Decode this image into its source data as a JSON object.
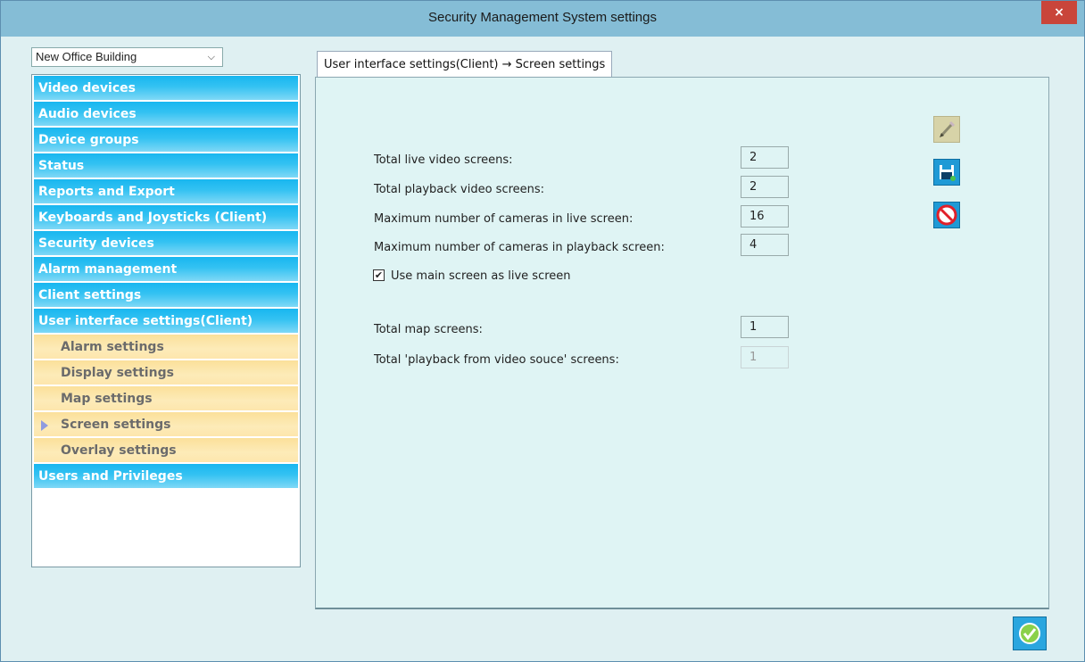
{
  "window": {
    "title": "Security Management System settings",
    "close_label": "×"
  },
  "site_selector": {
    "value": "New Office Building"
  },
  "nav": {
    "items": [
      {
        "label": "Video devices",
        "level": "top"
      },
      {
        "label": "Audio devices",
        "level": "top"
      },
      {
        "label": "Device groups",
        "level": "top"
      },
      {
        "label": "Status",
        "level": "top"
      },
      {
        "label": "Reports and Export",
        "level": "top"
      },
      {
        "label": "Keyboards and Joysticks (Client)",
        "level": "top"
      },
      {
        "label": "Security devices",
        "level": "top"
      },
      {
        "label": "Alarm management",
        "level": "top"
      },
      {
        "label": "Client settings",
        "level": "top"
      },
      {
        "label": "User interface settings(Client)",
        "level": "top"
      },
      {
        "label": "Alarm settings",
        "level": "sub"
      },
      {
        "label": "Display settings",
        "level": "sub"
      },
      {
        "label": "Map settings",
        "level": "sub"
      },
      {
        "label": "Screen settings",
        "level": "sub",
        "selected": true
      },
      {
        "label": "Overlay settings",
        "level": "sub"
      },
      {
        "label": "Users and Privileges",
        "level": "top"
      }
    ]
  },
  "tab": {
    "label": "User interface settings(Client) → Screen settings"
  },
  "settings": {
    "total_live_video_screens": {
      "label": "Total live video screens:",
      "value": "2"
    },
    "total_playback_video_screens": {
      "label": "Total playback video screens:",
      "value": "2"
    },
    "max_cameras_live": {
      "label": "Maximum number of cameras in live screen:",
      "value": "16"
    },
    "max_cameras_playback": {
      "label": "Maximum number of cameras in playback screen:",
      "value": "4"
    },
    "use_main_as_live": {
      "label": "Use main screen as live screen",
      "checked": true
    },
    "total_map_screens": {
      "label": "Total map  screens:",
      "value": "1"
    },
    "total_playback_from_source": {
      "label": "Total 'playback from video souce' screens:",
      "value": "1"
    }
  },
  "toolbar": {
    "edit_icon": "pencil-icon",
    "save_icon": "floppy-disk-icon",
    "cancel_icon": "no-entry-icon"
  },
  "ok_icon": "checkmark-icon",
  "colors": {
    "titlebar": "#85bdd6",
    "nav_top": "#34c2f2",
    "nav_sub": "#fde6ad",
    "panel_bg": "#dff4f4"
  }
}
